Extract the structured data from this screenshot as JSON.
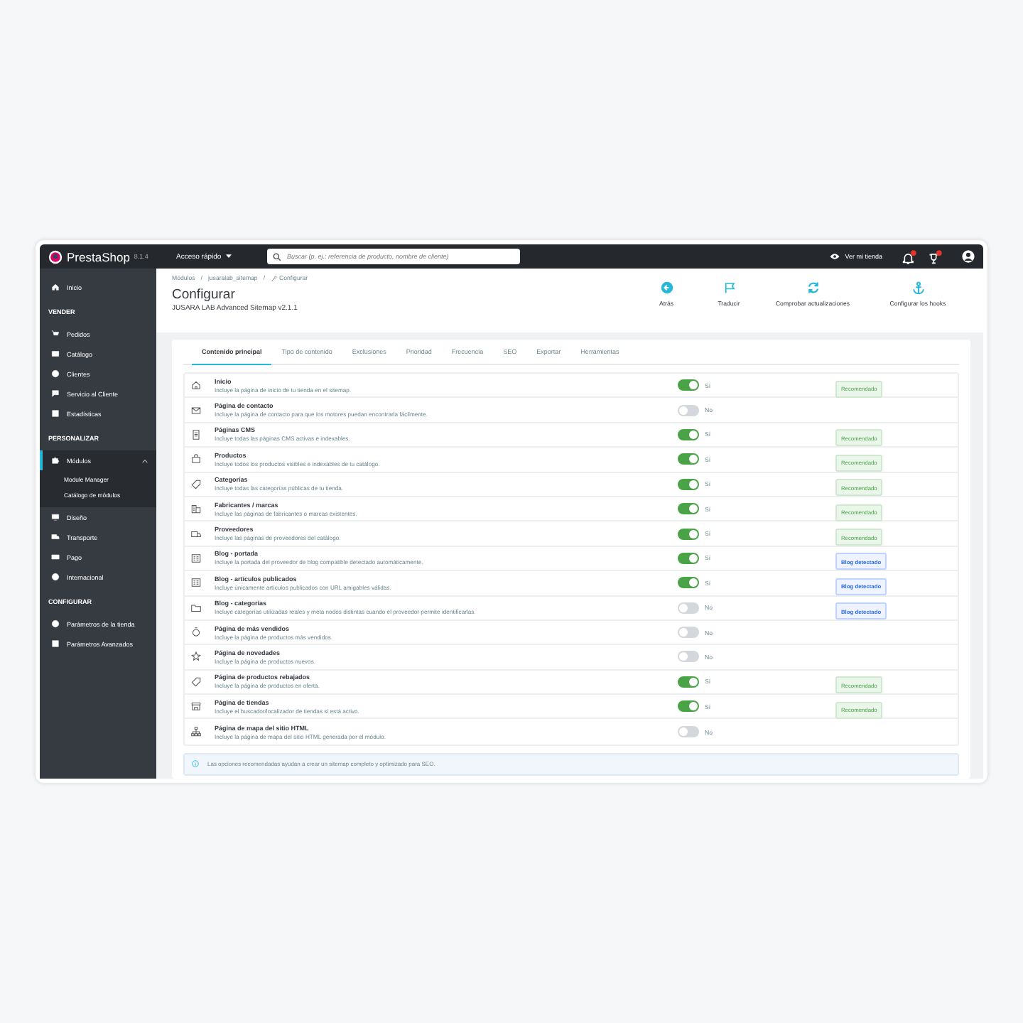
{
  "topbar": {
    "logo": "PrestaShop",
    "version": "8.1.4",
    "quick_access": "Acceso rápido",
    "search": {
      "placeholder": "Buscar (p. ej.: referencia de producto, nombre de cliente)"
    },
    "view_store": "Ver mi tienda"
  },
  "sidebar": {
    "sections": [
      {
        "items": [
          {
            "label": "Inicio",
            "selected": false
          }
        ]
      },
      {
        "title": "VENDER",
        "items": [
          {
            "label": "Pedidos",
            "selected": false
          },
          {
            "label": "Catálogo",
            "selected": false
          },
          {
            "label": "Clientes",
            "selected": false
          },
          {
            "label": "Servicio al Cliente",
            "selected": false
          },
          {
            "label": "Estadísticas",
            "selected": false
          }
        ]
      },
      {
        "title": "PERSONALIZAR",
        "items": [
          {
            "label": "Módulos",
            "selected": true,
            "expanded": true,
            "children": [
              {
                "label": "Module Manager"
              },
              {
                "label": "Catálogo de módulos"
              }
            ]
          },
          {
            "label": "Diseño",
            "selected": false
          },
          {
            "label": "Transporte",
            "selected": false
          },
          {
            "label": "Pago",
            "selected": false
          },
          {
            "label": "Internacional",
            "selected": false
          }
        ]
      },
      {
        "title": "CONFIGURAR",
        "items": [
          {
            "label": "Parámetros de la tienda",
            "selected": false
          },
          {
            "label": "Parámetros Avanzados",
            "selected": false
          }
        ]
      }
    ]
  },
  "breadcrumb": [
    "Módulos",
    "/",
    "jusaralab_sitemap",
    "/",
    "Configurar"
  ],
  "page": {
    "title": "Configurar",
    "subtitle": "JUSARA LAB Advanced Sitemap v2.1.1"
  },
  "toolbar": [
    "Atrás",
    "Traducir",
    "Comprobar actualizaciones",
    "Configurar los hooks"
  ],
  "tabs": [
    {
      "label": "Contenido principal",
      "selected": true
    },
    {
      "label": "Tipo de contenido",
      "selected": false
    },
    {
      "label": "Exclusiones",
      "selected": false
    },
    {
      "label": "Prioridad",
      "selected": false
    },
    {
      "label": "Frecuencia",
      "selected": false
    },
    {
      "label": "SEO",
      "selected": false
    },
    {
      "label": "Exportar",
      "selected": false
    },
    {
      "label": "Herramientas",
      "selected": false
    }
  ],
  "options": [
    {
      "title": "Inicio",
      "description": "Incluye la página de inicio de tu tienda en el sitemap.",
      "on": true,
      "state": "Sí",
      "badge": {
        "kind": "recommended",
        "text": "Recomendado"
      }
    },
    {
      "title": "Página de contacto",
      "description": "Incluye la página de contacto para que los motores puedan encontrarla fácilmente.",
      "on": false,
      "state": "No"
    },
    {
      "title": "Páginas CMS",
      "description": "Incluye todas las páginas CMS activas e indexables.",
      "on": true,
      "state": "Sí",
      "badge": {
        "kind": "recommended",
        "text": "Recomendado"
      }
    },
    {
      "title": "Productos",
      "description": "Incluye todos los productos visibles e indexables de tu catálogo.",
      "on": true,
      "state": "Sí",
      "badge": {
        "kind": "recommended",
        "text": "Recomendado"
      }
    },
    {
      "title": "Categorías",
      "description": "Incluye todas las categorías públicas de tu tienda.",
      "on": true,
      "state": "Sí",
      "badge": {
        "kind": "recommended",
        "text": "Recomendado"
      }
    },
    {
      "title": "Fabricantes / marcas",
      "description": "Incluye las páginas de fabricantes o marcas existentes.",
      "on": true,
      "state": "Sí",
      "badge": {
        "kind": "recommended",
        "text": "Recomendado"
      }
    },
    {
      "title": "Proveedores",
      "description": "Incluye las páginas de proveedores del catálogo.",
      "on": true,
      "state": "Sí",
      "badge": {
        "kind": "recommended",
        "text": "Recomendado"
      }
    },
    {
      "title": "Blog - portada",
      "description": "Incluye la portada del proveedor de blog compatible detectado automáticamente.",
      "on": true,
      "state": "Sí",
      "badge": {
        "kind": "blog",
        "text": "Blog detectado"
      }
    },
    {
      "title": "Blog - artículos publicados",
      "description": "Incluye únicamente artículos publicados con URL amigables válidas.",
      "on": true,
      "state": "Sí",
      "badge": {
        "kind": "blog",
        "text": "Blog detectado"
      }
    },
    {
      "title": "Blog - categorías",
      "description": "Incluye categorías utilizadas reales y meta nodos distintas cuando el proveedor permite identificarlas.",
      "on": false,
      "state": "No",
      "badge": {
        "kind": "blog",
        "text": "Blog detectado"
      }
    },
    {
      "title": "Página de más vendidos",
      "description": "Incluye la página de productos más vendidos.",
      "on": false,
      "state": "No"
    },
    {
      "title": "Página de novedades",
      "description": "Incluye la página de productos nuevos.",
      "on": false,
      "state": "No"
    },
    {
      "title": "Página de productos rebajados",
      "description": "Incluye la página de productos en oferta.",
      "on": true,
      "state": "Sí",
      "badge": {
        "kind": "recommended",
        "text": "Recomendado"
      }
    },
    {
      "title": "Página de tiendas",
      "description": "Incluye el buscador/localizador de tiendas si está activo.",
      "on": true,
      "state": "Sí",
      "badge": {
        "kind": "recommended",
        "text": "Recomendado"
      }
    },
    {
      "title": "Página de mapa del sitio HTML",
      "description": "Incluye la página de mapa del sitio HTML generada por el módulo.",
      "on": false,
      "state": "No"
    }
  ],
  "info": "Las opciones recomendadas ayudan a crear un sitemap completo y optimizado para SEO."
}
